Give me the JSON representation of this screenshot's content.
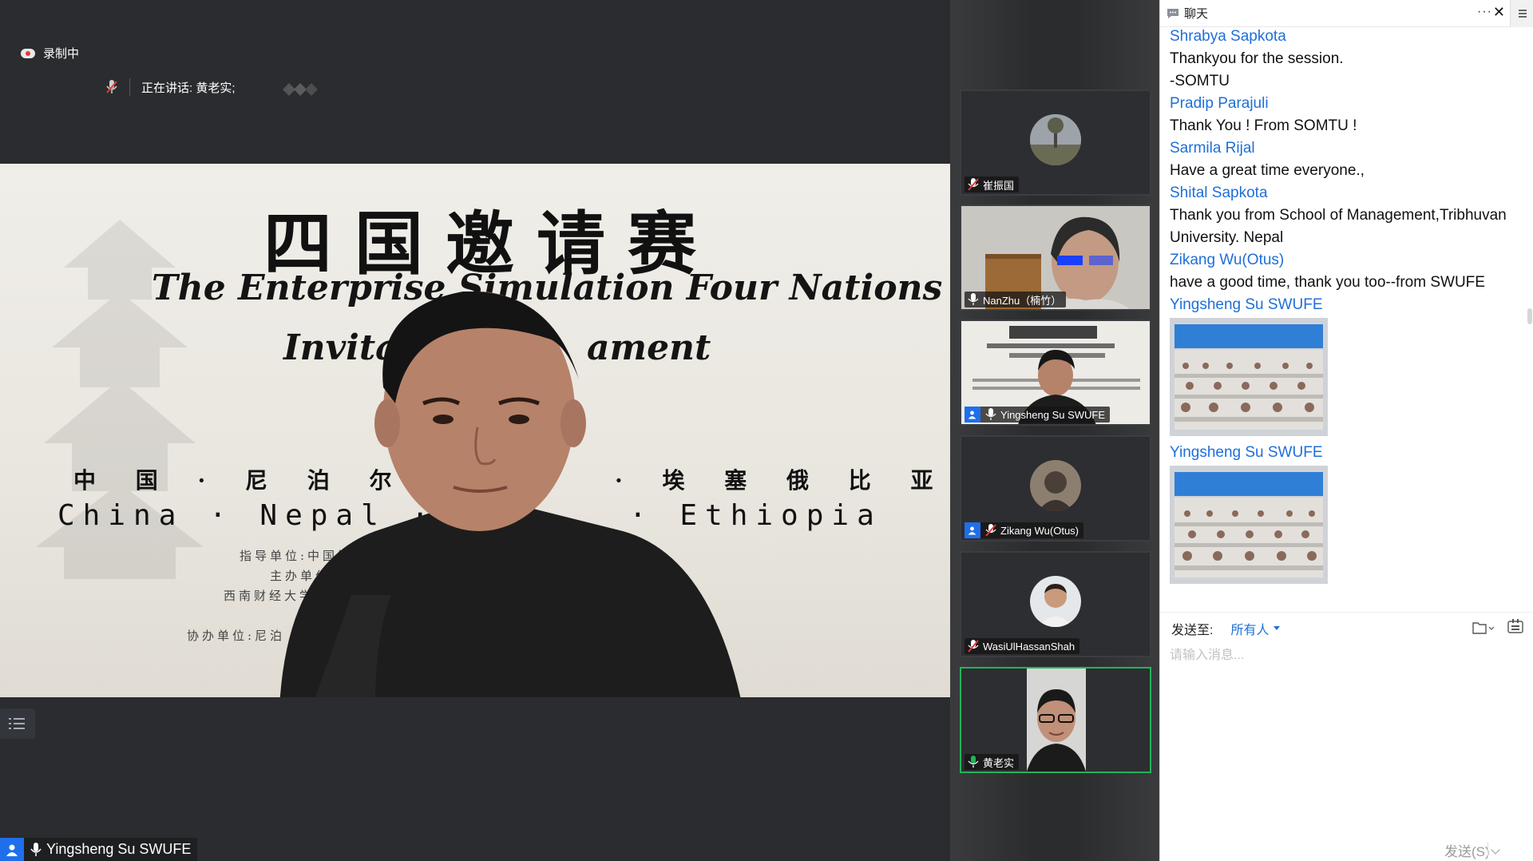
{
  "topbar": {
    "recording_label": "录制中",
    "speaking_label": "正在讲话: 黄老实;"
  },
  "slide": {
    "title_cn": "四国邀请赛",
    "title_en_line1": "The Enterprise Simulation Four Nations",
    "title_en_line2_visible_left": "Invitat",
    "title_en_line2_visible_right": "ament",
    "countries_cn_left": "中 国 · 尼 泊 尔 ·",
    "countries_cn_right": "· 埃 塞 俄 比 亚",
    "countries_en_left": "China · Nepal ·",
    "countries_en_right": "· Ethiopia",
    "line_guide": "指导单位:中国管理现代",
    "line_host": "主办单位:西南财经",
    "line_univ": "西南财经大学管",
    "line_co": "协办单位:尼泊"
  },
  "main_speaker": {
    "name": "Yingsheng Su  SWUFE"
  },
  "gallery": [
    {
      "name": "崔振国",
      "mic": "muted",
      "has_user_badge": false,
      "active": false
    },
    {
      "name": "NanZhu（楠竹）",
      "mic": "on",
      "has_user_badge": false,
      "active": false
    },
    {
      "name": "Yingsheng Su  SWUFE",
      "mic": "on",
      "has_user_badge": true,
      "active": false
    },
    {
      "name": "Zikang Wu(Otus)",
      "mic": "muted",
      "has_user_badge": true,
      "active": false
    },
    {
      "name": "WasiUlHassanShah",
      "mic": "muted",
      "has_user_badge": false,
      "active": false
    },
    {
      "name": "黄老实",
      "mic": "speaking",
      "has_user_badge": false,
      "active": true
    }
  ],
  "chat": {
    "title": "聊天",
    "messages": [
      {
        "sender": "Shrabya Sapkota",
        "lines": [
          "Thankyou for the session.",
          "-SOMTU"
        ]
      },
      {
        "sender": "Pradip Parajuli",
        "lines": [
          "Thank You ! From SOMTU !"
        ]
      },
      {
        "sender": "Sarmila Rijal",
        "lines": [
          "Have a great time  everyone.,"
        ]
      },
      {
        "sender": "Shital Sapkota",
        "lines": [
          "Thank you from School of Management,Tribhuvan University. Nepal"
        ]
      },
      {
        "sender": "Zikang Wu(Otus)",
        "lines": [
          "have a good time, thank you too--from SWUFE"
        ]
      },
      {
        "sender": "Yingsheng Su  SWUFE",
        "image": true
      },
      {
        "sender": "Yingsheng Su  SWUFE",
        "image": true
      }
    ],
    "send_to_label": "发送至:",
    "send_to_value": "所有人",
    "input_placeholder": "请输入消息...",
    "send_button": "发送(S)"
  },
  "colors": {
    "accent_blue": "#1e6fd9",
    "active_green": "#22b45a",
    "muted_red": "#e53935",
    "user_blue": "#1f6feb"
  }
}
